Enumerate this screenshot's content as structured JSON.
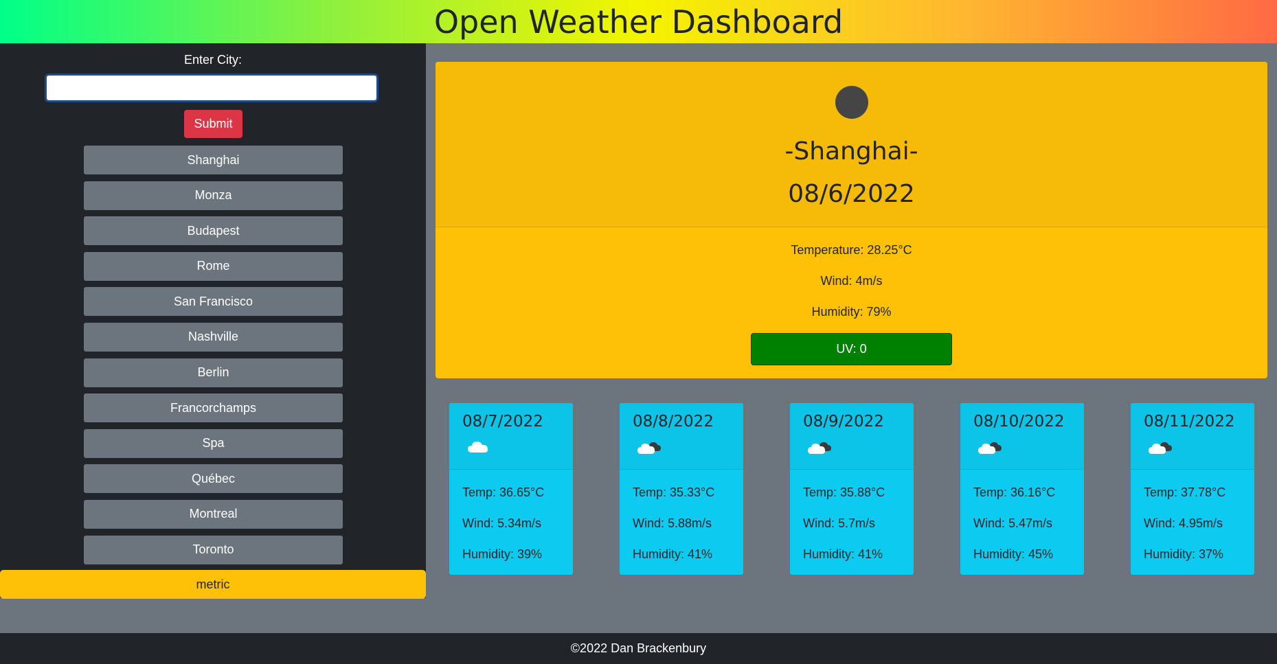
{
  "header": {
    "title": "Open Weather Dashboard"
  },
  "search": {
    "label": "Enter City:",
    "value": "",
    "placeholder": "",
    "submit_label": "Submit"
  },
  "history": [
    "Shanghai",
    "Monza",
    "Budapest",
    "Rome",
    "San Francisco",
    "Nashville",
    "Berlin",
    "Francorchamps",
    "Spa",
    "Québec",
    "Montreal",
    "Toronto"
  ],
  "unit_toggle": "metric",
  "current": {
    "icon": "weather-icon",
    "city": "-Shanghai-",
    "date": "08/6/2022",
    "temperature": "Temperature: 28.25°C",
    "wind": "Wind: 4m/s",
    "humidity": "Humidity: 79%",
    "uv": "UV: 0",
    "uv_color": "#008000"
  },
  "forecast": [
    {
      "date": "08/7/2022",
      "icon": "cloud-icon",
      "temp": "Temp: 36.65°C",
      "wind": "Wind: 5.34m/s",
      "humidity": "Humidity: 39%"
    },
    {
      "date": "08/8/2022",
      "icon": "broken-clouds-icon",
      "temp": "Temp: 35.33°C",
      "wind": "Wind: 5.88m/s",
      "humidity": "Humidity: 41%"
    },
    {
      "date": "08/9/2022",
      "icon": "broken-clouds-icon",
      "temp": "Temp: 35.88°C",
      "wind": "Wind: 5.7m/s",
      "humidity": "Humidity: 41%"
    },
    {
      "date": "08/10/2022",
      "icon": "broken-clouds-icon",
      "temp": "Temp: 36.16°C",
      "wind": "Wind: 5.47m/s",
      "humidity": "Humidity: 45%"
    },
    {
      "date": "08/11/2022",
      "icon": "broken-clouds-icon",
      "temp": "Temp: 37.78°C",
      "wind": "Wind: 4.95m/s",
      "humidity": "Humidity: 37%"
    }
  ],
  "footer": {
    "text": "©2022 Dan Brackenbury"
  },
  "colors": {
    "danger": "#dc3545",
    "secondary": "#6c757d",
    "warning": "#ffc107",
    "info": "#0dcaf0",
    "dark": "#212529"
  }
}
